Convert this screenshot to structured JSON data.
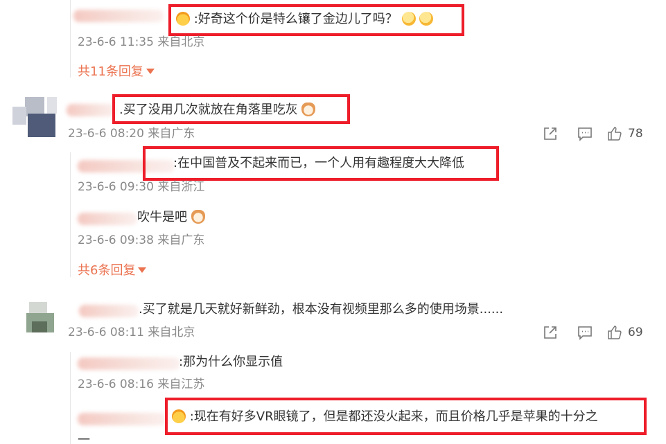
{
  "comments": [
    {
      "id": "c0",
      "text": ":好奇这个价是特么镶了金边儿了吗？",
      "time": "23-6-6 11:35",
      "location": "来自北京",
      "more_replies": "共11条回复"
    },
    {
      "id": "c1",
      "text": ".买了没用几次就放在角落里吃灰",
      "time": "23-6-6 08:20",
      "location": "来自广东",
      "likes": "78",
      "replies": [
        {
          "text": ":在中国普及不起来而已，一个人用有趣程度大大降低",
          "time": "23-6-6 09:30",
          "location": "来自浙江"
        },
        {
          "text": "吹牛是吧",
          "time": "23-6-6 09:38",
          "location": "来自广东"
        }
      ],
      "more_replies": "共6条回复"
    },
    {
      "id": "c2",
      "text": ".买了就是几天就好新鲜劲，根本没有视频里那么多的使用场景......",
      "time": "23-6-6 08:11",
      "location": "来自北京",
      "likes": "69",
      "replies": [
        {
          "text": ":那为什么你显示值",
          "time": "23-6-6 08:16",
          "location": "来自江苏"
        },
        {
          "text": ":现在有好多VR眼镜了，但是都还没火起来，而且价格几乎是苹果的十分之",
          "text_wrap": "一"
        }
      ]
    }
  ],
  "icons": {
    "share": "share-icon",
    "comment": "comment-icon",
    "like": "thumbs-up-icon"
  },
  "colors": {
    "highlight": "#ee1d2a",
    "more_link": "#eb7350",
    "meta": "#8a8a8a"
  }
}
